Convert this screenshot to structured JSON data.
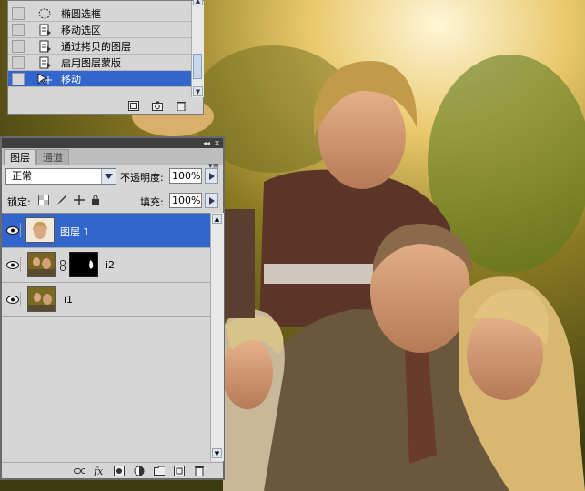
{
  "history": {
    "items": [
      {
        "label": "椭圆选框",
        "icon": "ellipse-marquee-icon",
        "selected": false
      },
      {
        "label": "移动选区",
        "icon": "history-state-icon",
        "selected": false
      },
      {
        "label": "通过拷贝的图层",
        "icon": "history-state-icon",
        "selected": false
      },
      {
        "label": "启用图层蒙版",
        "icon": "history-state-icon",
        "selected": false
      },
      {
        "label": "移动",
        "icon": "move-tool-icon",
        "selected": true
      }
    ]
  },
  "layers_panel": {
    "tabs": [
      {
        "label": "图层",
        "active": true
      },
      {
        "label": "通道",
        "active": false
      }
    ],
    "blend_mode": "正常",
    "opacity_label": "不透明度:",
    "opacity_value": "100%",
    "lock_label": "锁定:",
    "fill_label": "填充:",
    "fill_value": "100%",
    "layers": [
      {
        "name": "图层 1",
        "selected": true,
        "visible": true,
        "has_mask": false
      },
      {
        "name": "i2",
        "selected": false,
        "visible": true,
        "has_mask": true
      },
      {
        "name": "i1",
        "selected": false,
        "visible": true,
        "has_mask": false
      }
    ]
  },
  "colors": {
    "selection": "#3366cc",
    "panel_bg": "#d6d6d6",
    "title_bar": "#3e3e3e"
  }
}
